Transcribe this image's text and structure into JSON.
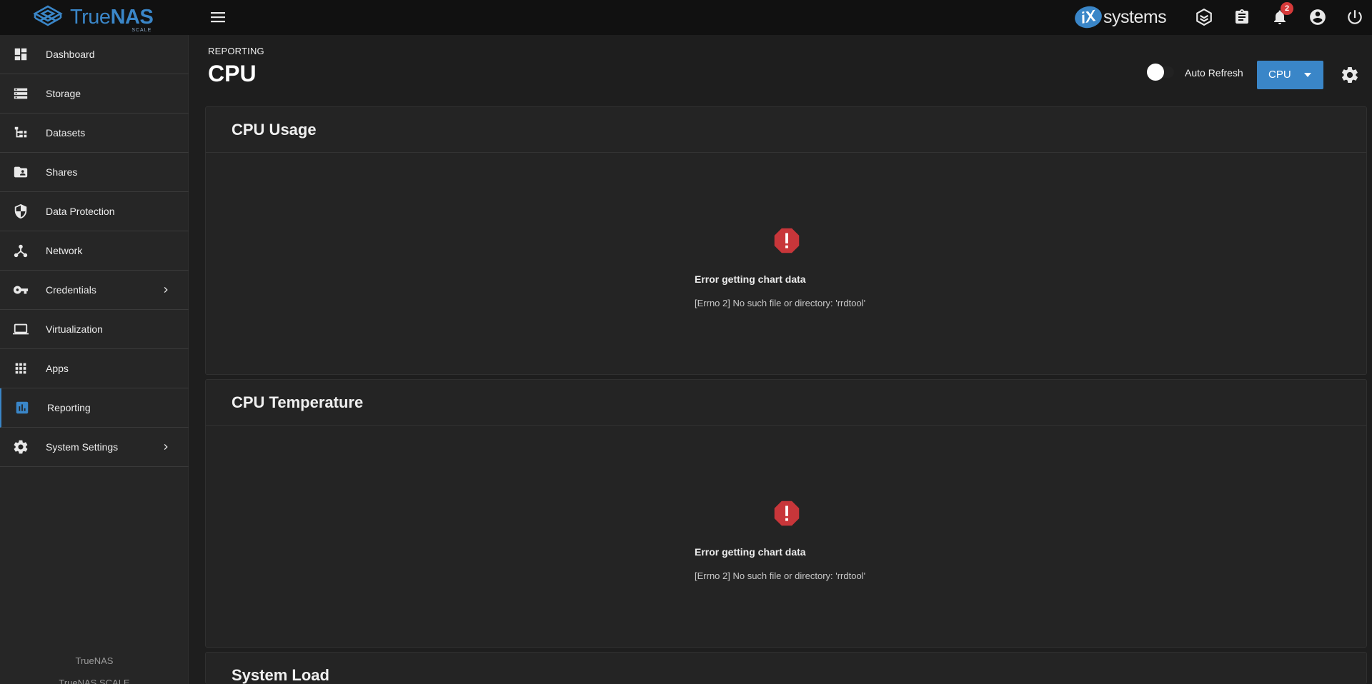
{
  "app": {
    "logo_main": "TrueNAS",
    "logo_main_a": "True",
    "logo_main_b": "NAS",
    "logo_sub": "SCALE",
    "vendor_logo_badge": "iX",
    "vendor_logo_text": "systems"
  },
  "topbar": {
    "icons": [
      "menu-icon",
      "truecommand-icon",
      "clipboard-icon",
      "bell-icon",
      "account-circle-icon",
      "power-icon"
    ],
    "notification_count": "2"
  },
  "sidebar": {
    "items": [
      {
        "label": "Dashboard",
        "icon": "dashboard-icon"
      },
      {
        "label": "Storage",
        "icon": "storage-icon"
      },
      {
        "label": "Datasets",
        "icon": "datasets-icon"
      },
      {
        "label": "Shares",
        "icon": "shares-icon"
      },
      {
        "label": "Data Protection",
        "icon": "shield-icon"
      },
      {
        "label": "Network",
        "icon": "network-icon"
      },
      {
        "label": "Credentials",
        "icon": "key-icon"
      },
      {
        "label": "Virtualization",
        "icon": "laptop-icon"
      },
      {
        "label": "Apps",
        "icon": "apps-grid-icon"
      },
      {
        "label": "Reporting",
        "icon": "bar-chart-icon",
        "active": true
      },
      {
        "label": "System Settings",
        "icon": "gear-icon"
      }
    ],
    "footer": "TrueNAS",
    "footer_version": "TrueNAS SCALE"
  },
  "page": {
    "breadcrumb": "REPORTING",
    "title": "CPU",
    "auto_refresh_label": "Auto Refresh",
    "auto_refresh_on": false,
    "report_select_value": "CPU"
  },
  "cards": [
    {
      "title": "CPU Usage",
      "error_title": "Error getting chart data",
      "error_msg": "[Errno 2] No such file or directory: 'rrdtool'"
    },
    {
      "title": "CPU Temperature",
      "error_title": "Error getting chart data",
      "error_msg": "[Errno 2] No such file or directory: 'rrdtool'"
    },
    {
      "title": "System Load"
    }
  ],
  "colors": {
    "accent": "#3a86c8",
    "error": "#d63a3a",
    "topbar_bg": "#111111",
    "sidebar_bg": "#262626",
    "card_bg": "#242424"
  }
}
